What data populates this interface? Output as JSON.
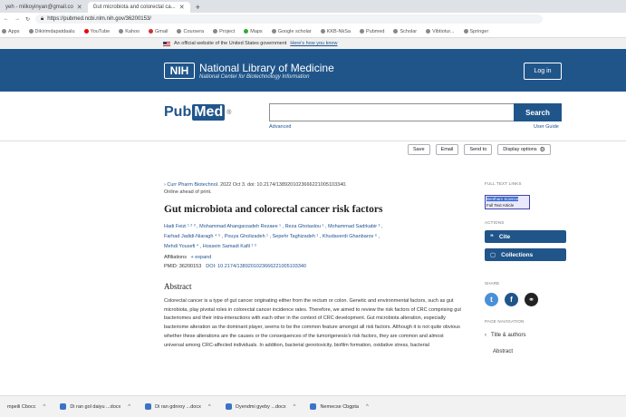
{
  "browser": {
    "tabs": [
      {
        "label": "yeh - milkoyinyan@gmail.co",
        "active": false
      },
      {
        "label": "Gut microbiota and colorectal ca...",
        "active": true
      }
    ],
    "address": "https://pubmed.ncbi.nlm.nih.gov/36200153/",
    "bookmarks": [
      "Apps",
      "Dikirimdapatdaalu",
      "YouTube",
      "Kahoo",
      "Gmail",
      "Coursera",
      "Project",
      "Maps",
      "Google scholar",
      "KKB-NkSa",
      "Pubmed",
      "Scholar",
      "Vibtiotur...",
      "Springer"
    ]
  },
  "gov_banner": {
    "text": "An official website of the United States government",
    "link": "Here's how you know"
  },
  "nlm": {
    "logo": "NIH",
    "title": "National Library of Medicine",
    "subtitle": "National Center for Biotechnology Information",
    "login": "Log in"
  },
  "search": {
    "logo_pub": "Pub",
    "logo_med": "Med",
    "logo_reg": "®",
    "placeholder": "",
    "button": "Search",
    "advanced": "Advanced",
    "user_guide": "User Guide"
  },
  "actions_bar": {
    "save": "Save",
    "email": "Email",
    "send_to": "Send to",
    "display_options": "Display options"
  },
  "article": {
    "journal": "Curr Pharm Biotechnol",
    "citation_rest": ". 2022 Oct 3. doi: 10.2174/1389201023666221005103340.",
    "online": "Online ahead of print.",
    "title": "Gut microbiota and colorectal cancer risk factors",
    "authors_line1": "Hadi Feizi ¹ ² ³ , Mohammad Ahangarzadeh Rezaee ¹ , Reza Ghotaslou ¹ , Mohammad Sadrkabir ² ,",
    "authors_line2": "Farhad Jadidi-Niaragh ⁴ ⁵ , Pouya Gholizadeh ¹ , Sepehr Taghizadeh ¹ , Khudaverdi Ghanbarov ⁶ ,",
    "authors_line3": "Mehdi Yousefi ⁴ , Hossein Samadi Kafil ¹ ³",
    "affiliations": "Affiliations",
    "expand": "+ expand",
    "pmid": "PMID: 36200153",
    "doi": "DOI: 10.2174/1389201023666221005103340",
    "abstract_heading": "Abstract",
    "abstract": "Colorectal cancer is a type of gut cancer originating either from the rectum or colon. Genetic and environmental factors, such as gut microbiota, play pivotal roles in colorectal cancer incidence rates. Therefore, we aimed to review the risk factors of CRC comprising gut bacteriomes and their intra-interactions with each other in the context of CRC development. Gut microbiota alteration, especially bacteriome alteration as the dominant player, seems to be the common feature amongst all risk factors. Although it is not quite obvious whether these alterations are the causes or the consequences of the tumorigenesis's risk factors, they are common and almost universal among CRC-affected individuals. In addition, bacterial genotoxicity, biofilm formation, oxidative stress, bacterial"
  },
  "sidebar": {
    "full_text_label": "FULL TEXT LINKS",
    "full_text_line1": "Bentham Science",
    "full_text_line2": "Full Text Article",
    "actions_label": "ACTIONS",
    "cite": "Cite",
    "collections": "Collections",
    "share_label": "SHARE",
    "page_nav_label": "PAGE NAVIGATION",
    "title_authors": "Title & authors",
    "abstract": "Abstract"
  },
  "taskbar": {
    "items": [
      "mpeili Cbocc",
      "Di ran gol daiyu ...docx",
      "Di ran gdnroy ...docx",
      "Oyendmi gyeby ...docx",
      "Nemecse Cbgpta"
    ]
  }
}
